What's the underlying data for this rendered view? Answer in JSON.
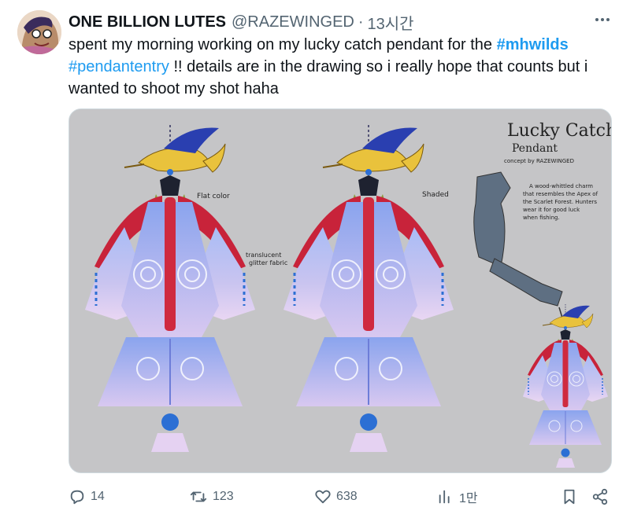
{
  "tweet": {
    "author_name": "ONE BILLION LUTES",
    "author_handle": "@RAZEWINGED",
    "separator": "·",
    "timestamp": "13시간",
    "text_part1": "spent my morning working on my lucky catch pendant for the ",
    "hashtag1": "#mhwilds",
    "text_part2": " ",
    "hashtag2": "#pendantentry",
    "text_part3": " !! details are in the drawing so i really hope that counts but i wanted to shoot my shot haha"
  },
  "artwork": {
    "title_line1": "Lucky Catch",
    "title_line2": "Pendant",
    "credit": "concept by RAZEWINGED",
    "label_flat": "Flat color",
    "label_shaded": "Shaded",
    "label_fabric_line1": "translucent",
    "label_fabric_line2": "glitter fabric",
    "desc_line1": "A wood-whittled charm",
    "desc_line2": "that resembles the Apex of",
    "desc_line3": "the Scarlet Forest. Hunters",
    "desc_line4": "wear it for good luck",
    "desc_line5": "when fishing."
  },
  "actions": {
    "replies": "14",
    "reposts": "123",
    "likes": "638",
    "views": "1만"
  },
  "colors": {
    "accent": "#1d9bf0",
    "muted": "#536471",
    "media_bg": "#c5c5c7"
  },
  "icons": [
    "more-icon",
    "reply-icon",
    "repost-icon",
    "like-icon",
    "views-icon",
    "bookmark-icon",
    "share-icon"
  ]
}
